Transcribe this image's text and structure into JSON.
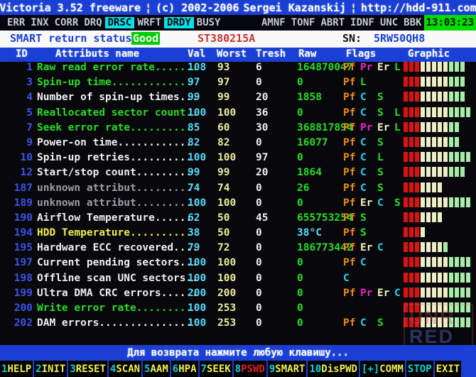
{
  "app": {
    "title_parts": [
      "Victoria 3.52 freeware",
      "¦",
      "(c) 2002-2006",
      "Sergei Kazanskij",
      "¦",
      "http://hdd-911.com"
    ]
  },
  "registers": {
    "left": [
      {
        "label": "ERR",
        "active": false
      },
      {
        "label": "INX",
        "active": false
      },
      {
        "label": "CORR",
        "active": false
      },
      {
        "label": "DRQ",
        "active": false
      },
      {
        "label": "DRSC",
        "active": true
      },
      {
        "label": "WRFT",
        "active": false
      },
      {
        "label": "DRDY",
        "active": true
      },
      {
        "label": "BUSY",
        "active": false
      }
    ],
    "right": [
      {
        "label": "AMNF",
        "active": false
      },
      {
        "label": "TONF",
        "active": false
      },
      {
        "label": "ABRT",
        "active": false
      },
      {
        "label": "IDNF",
        "active": false
      },
      {
        "label": "UNC",
        "active": false
      },
      {
        "label": "BBK",
        "active": false
      }
    ],
    "clock": "13:03:23"
  },
  "smart": {
    "status_label": "SMART return status:",
    "status_value": "Good",
    "model": "ST380215A",
    "sn_label": "SN:",
    "sn_value": "5RW50QH8"
  },
  "table": {
    "headers": {
      "id": "ID",
      "name": "Attributs name",
      "val": "Val",
      "worst": "Worst",
      "tresh": "Tresh",
      "raw": "Raw",
      "flags": "Flags",
      "graphic": "Graphic"
    },
    "rows": [
      {
        "id": "1",
        "name": "Raw read error rate.......",
        "name_color": "green",
        "val": "108",
        "worst": "93",
        "tresh": "6",
        "raw": "164870047",
        "raw_color": "green",
        "flags": [
          "Pf",
          "Pr",
          "Er",
          "L"
        ],
        "bars": [
          3,
          5,
          3
        ]
      },
      {
        "id": "3",
        "name": "Spin-up time.............",
        "name_color": "green",
        "val": "97",
        "worst": "97",
        "tresh": "0",
        "raw": "0",
        "raw_color": "green",
        "flags": [
          "Pf",
          "L"
        ],
        "bars": [
          3,
          5,
          3
        ]
      },
      {
        "id": "4",
        "name": "Number of spin-up times...",
        "name_color": "white",
        "val": "99",
        "worst": "99",
        "tresh": "20",
        "raw": "1858",
        "raw_color": "green",
        "flags": [
          "Pf",
          "C",
          "S"
        ],
        "bars": [
          3,
          5,
          3
        ]
      },
      {
        "id": "5",
        "name": "Reallocated sector count..",
        "name_color": "green",
        "val": "100",
        "worst": "100",
        "tresh": "36",
        "raw": "0",
        "raw_color": "green",
        "flags": [
          "Pf",
          "C",
          "S",
          "L"
        ],
        "bars": [
          3,
          5,
          4
        ]
      },
      {
        "id": "7",
        "name": "Seek error rate..........",
        "name_color": "green",
        "val": "85",
        "worst": "60",
        "tresh": "30",
        "raw": "368817894",
        "raw_color": "green",
        "flags": [
          "Pf",
          "Pr",
          "Er",
          "L"
        ],
        "bars": [
          3,
          5,
          2
        ]
      },
      {
        "id": "9",
        "name": "Power-on time............",
        "name_color": "white",
        "val": "82",
        "worst": "82",
        "tresh": "0",
        "raw": "16077",
        "raw_color": "green",
        "flags": [
          "Pf",
          "C",
          "S"
        ],
        "bars": [
          3,
          5,
          2
        ]
      },
      {
        "id": "10",
        "name": "Spin-up retries..........",
        "name_color": "white",
        "val": "100",
        "worst": "100",
        "tresh": "97",
        "raw": "0",
        "raw_color": "green",
        "flags": [
          "Pf",
          "C",
          "L"
        ],
        "bars": [
          3,
          5,
          4
        ]
      },
      {
        "id": "12",
        "name": "Start/stop count.........",
        "name_color": "white",
        "val": "99",
        "worst": "99",
        "tresh": "20",
        "raw": "1864",
        "raw_color": "green",
        "flags": [
          "Pf",
          "C",
          "S"
        ],
        "bars": [
          3,
          5,
          3
        ]
      },
      {
        "id": "187",
        "name": "unknown attribut.........",
        "name_color": "gray",
        "val": "74",
        "worst": "74",
        "tresh": "0",
        "raw": "26",
        "raw_color": "green",
        "flags": [
          "Pf",
          "C",
          "S"
        ],
        "bars": [
          3,
          4,
          0
        ]
      },
      {
        "id": "189",
        "name": "unknown attribut.........",
        "name_color": "gray",
        "val": "100",
        "worst": "100",
        "tresh": "0",
        "raw": "0",
        "raw_color": "green",
        "flags": [
          "Pf",
          "Er",
          "C",
          "S"
        ],
        "bars": [
          3,
          5,
          4
        ]
      },
      {
        "id": "190",
        "name": "Airflow Temperature......",
        "name_color": "white",
        "val": "62",
        "worst": "50",
        "tresh": "45",
        "raw": "655753254",
        "raw_color": "green",
        "flags": [
          "Pf",
          "S"
        ],
        "bars": [
          3,
          4,
          0
        ]
      },
      {
        "id": "194",
        "name": "HDD Temperature..........",
        "name_color": "yellow",
        "val": "38",
        "worst": "50",
        "tresh": "0",
        "raw": "38°C",
        "raw_color": "cyan",
        "flags": [
          "Pf",
          "S"
        ],
        "bars": [
          3,
          1,
          0
        ]
      },
      {
        "id": "195",
        "name": "Hardware ECC recovered....",
        "name_color": "white",
        "val": "79",
        "worst": "72",
        "tresh": "0",
        "raw": "186773442",
        "raw_color": "green",
        "flags": [
          "Pf",
          "Er",
          "C"
        ],
        "bars": [
          3,
          4,
          1
        ]
      },
      {
        "id": "197",
        "name": "Current pending sectors...",
        "name_color": "white",
        "val": "100",
        "worst": "100",
        "tresh": "0",
        "raw": "0",
        "raw_color": "green",
        "flags": [
          "Pf",
          "C"
        ],
        "bars": [
          3,
          5,
          4
        ]
      },
      {
        "id": "198",
        "name": "Offline scan UNC sectors..",
        "name_color": "white",
        "val": "100",
        "worst": "100",
        "tresh": "0",
        "raw": "0",
        "raw_color": "green",
        "flags": [
          "C"
        ],
        "bars": [
          3,
          5,
          4
        ]
      },
      {
        "id": "199",
        "name": "Ultra DMA CRC errors......",
        "name_color": "white",
        "val": "200",
        "worst": "200",
        "tresh": "0",
        "raw": "0",
        "raw_color": "green",
        "flags": [
          "Pf",
          "Pr",
          "Er",
          "C"
        ],
        "bars": [
          3,
          5,
          4
        ]
      },
      {
        "id": "200",
        "name": "Write error rate.........",
        "name_color": "green",
        "val": "100",
        "worst": "253",
        "tresh": "0",
        "raw": "0",
        "raw_color": "green",
        "flags": [],
        "bars": [
          3,
          5,
          4
        ]
      },
      {
        "id": "202",
        "name": "DAM errors...............",
        "name_color": "white",
        "val": "100",
        "worst": "253",
        "tresh": "0",
        "raw": "0",
        "raw_color": "green",
        "flags": [
          "Pf",
          "C",
          "S"
        ],
        "bars": [
          3,
          5,
          4
        ]
      }
    ]
  },
  "footer": {
    "hint": "Для возврата нажмите любую клавишу...",
    "fkeys": [
      {
        "num": "1",
        "label": "HELP",
        "label_color": "yellow"
      },
      {
        "num": "2",
        "label": "INIT",
        "label_color": "yellow"
      },
      {
        "num": "3",
        "label": "RESET",
        "label_color": "yellow"
      },
      {
        "num": "4",
        "label": "SCAN",
        "label_color": "yellow"
      },
      {
        "num": "5",
        "label": "AAM",
        "label_color": "yellow"
      },
      {
        "num": "6",
        "label": "HPA",
        "label_color": "yellow"
      },
      {
        "num": "7",
        "label": "SEEK",
        "label_color": "yellow"
      },
      {
        "num": "8",
        "label": "PSWD",
        "label_color": "red"
      },
      {
        "num": "9",
        "label": "SMART",
        "label_color": "yellow"
      },
      {
        "num": "10",
        "label": "DisPWD",
        "label_color": "yellow"
      },
      {
        "num": "[+]",
        "label": "COMM",
        "label_color": "yellow"
      },
      {
        "num": "",
        "label": "STOP",
        "label_color": "cyan"
      },
      {
        "num": "",
        "label": "EXIT",
        "label_color": "yellow"
      }
    ]
  },
  "watermark": {
    "line1": "UNR",
    "line2": "RED",
    "big": "RED"
  },
  "colors": {
    "accent_blue": "#1a3fd8",
    "highlight_cyan": "#00e6f0",
    "clock_green": "#00e000",
    "good_green": "#00d000",
    "bar_red": "#e01010",
    "bar_yellow": "#f2f2c8",
    "bar_green": "#a8f0a8"
  }
}
